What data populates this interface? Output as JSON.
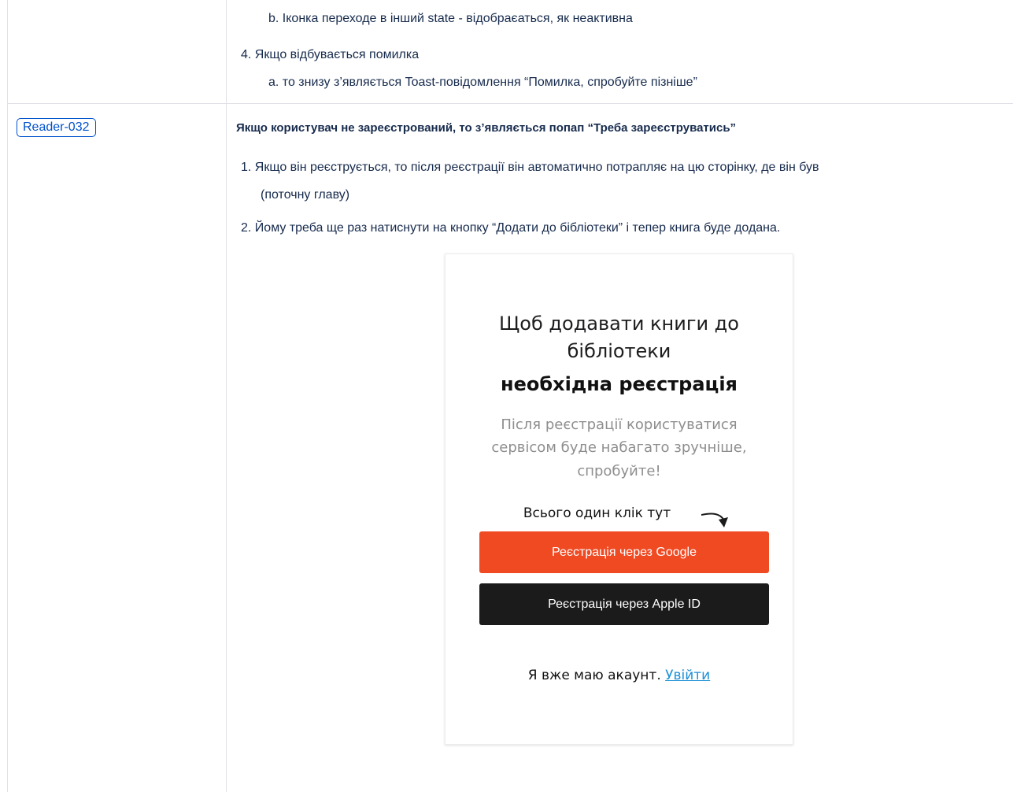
{
  "prev_row": {
    "item_3b": "b. Іконка переходе в інший state - відобраєаться, як неактивна",
    "item_4": "4. Якщо відбувається помилка",
    "item_4a": "a. то знизу з’являється Toast-повідомлення “Помилка, спробуйте пізніше”"
  },
  "row": {
    "id": "Reader-032",
    "heading": "Якщо користувач не зареєстрований, то з’являється попап “Треба зареєструватись”",
    "item_1_line1": "1. Якщо він реєструється, то після реєстрації він автоматично потрапляє на цю сторінку, де він був",
    "item_1_line2": "(поточну главу)",
    "item_2": "2. Йому треба ще раз натиснути на кнопку “Додати до бібліотеки” і тепер книга буде додана."
  },
  "popup": {
    "title_line1": "Щоб додавати книги до",
    "title_line2": "бібліотеки",
    "title_bold": "необхідна реєстрація",
    "subtitle_line1": "Після реєстрації користуватися",
    "subtitle_line2": "сервісом буде набагато зручніше,",
    "subtitle_line3": "спробуйте!",
    "hint": "Всього один клік тут",
    "google_button": "Реєстрація через Google",
    "apple_button": "Реєстрація через Apple ID",
    "footer_text": "Я вже маю акаунт. ",
    "login_link": "Увійти",
    "colors": {
      "google": "#f04a23",
      "apple": "#1b1b1b",
      "link": "#1a8fd6"
    }
  }
}
